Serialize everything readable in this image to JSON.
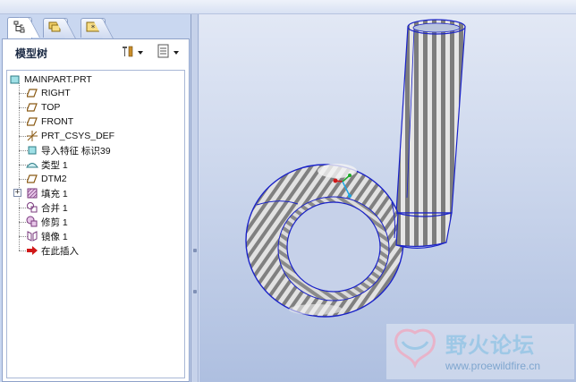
{
  "navigator": {
    "tabs": [
      {
        "name": "model-tree-tab-icon",
        "active": true
      },
      {
        "name": "folder-browser-tab-icon",
        "active": false
      },
      {
        "name": "favorites-tab-icon",
        "active": false
      }
    ],
    "title": "模型树",
    "settings_icon": "settings-tools-icon",
    "show_icon": "show-list-icon"
  },
  "tree": {
    "root": {
      "label": "MAINPART.PRT",
      "icon": "part-icon"
    },
    "items": [
      {
        "label": "RIGHT",
        "icon": "datum-plane-icon"
      },
      {
        "label": "TOP",
        "icon": "datum-plane-icon"
      },
      {
        "label": "FRONT",
        "icon": "datum-plane-icon"
      },
      {
        "label": "PRT_CSYS_DEF",
        "icon": "csys-icon"
      },
      {
        "label": "导入特征 标识39",
        "icon": "import-feature-icon"
      },
      {
        "label": "类型 1",
        "icon": "type-feature-icon"
      },
      {
        "label": "DTM2",
        "icon": "datum-plane-icon"
      },
      {
        "label": "填充 1",
        "icon": "fill-surface-icon",
        "expandable": true
      },
      {
        "label": "合并 1",
        "icon": "merge-icon"
      },
      {
        "label": "修剪 1",
        "icon": "trim-icon"
      },
      {
        "label": "镜像 1",
        "icon": "mirror-icon"
      },
      {
        "label": "在此插入",
        "icon": "insert-here-arrow-icon"
      }
    ]
  },
  "watermark": {
    "title": "野火论坛",
    "url": "www.proewildfire.cn"
  },
  "colors": {
    "model_edge": "#1a22c8",
    "model_light": "#e8e8e8",
    "model_dark": "#7c7c7c",
    "viewport_top": "#e2e8f5",
    "viewport_bottom": "#aebfe0"
  }
}
